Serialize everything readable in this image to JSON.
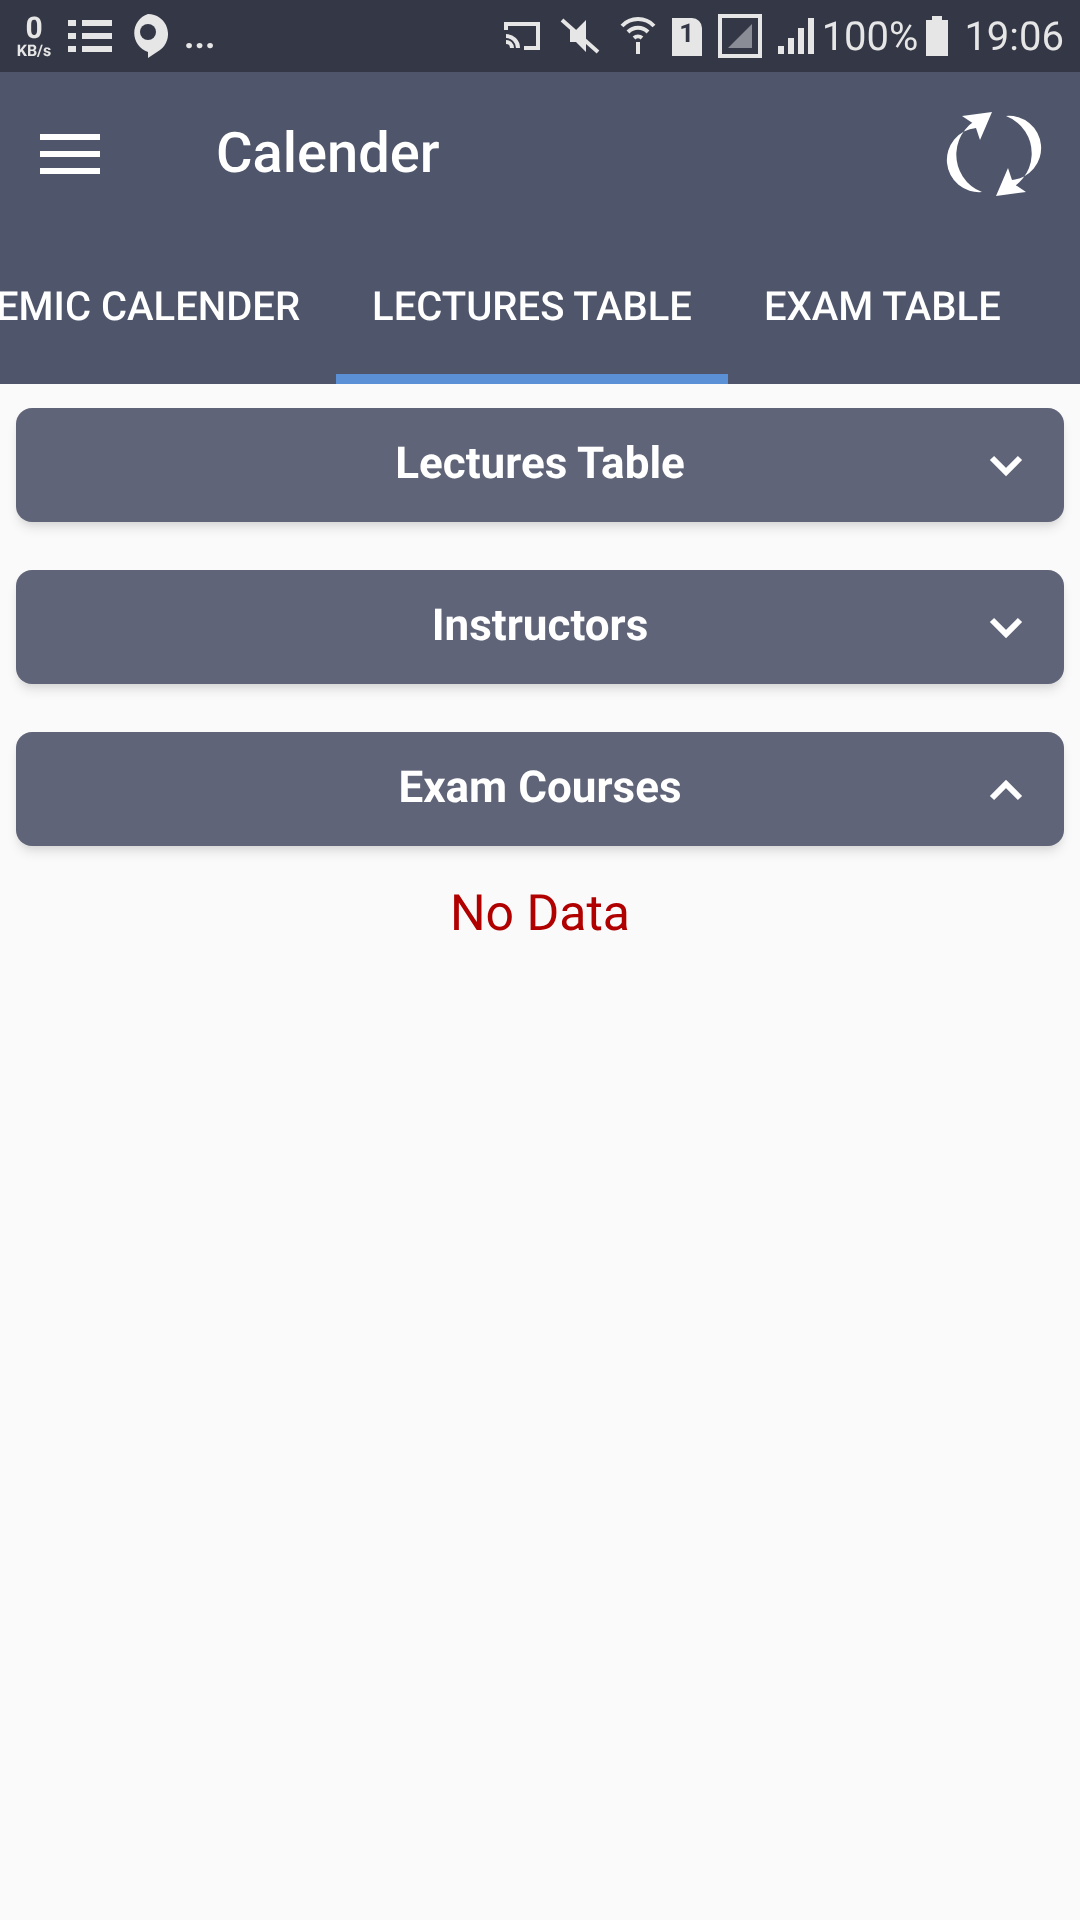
{
  "status_bar": {
    "speed_value": "0",
    "speed_unit": "KB/s",
    "more": "...",
    "sim": "1",
    "battery": "100%",
    "time": "19:06"
  },
  "app_bar": {
    "title": "Calender"
  },
  "tabs": [
    {
      "label": "EMIC CALENDER",
      "selected": false
    },
    {
      "label": "LECTURES TABLE",
      "selected": true
    },
    {
      "label": "EXAM TABLE",
      "selected": false
    }
  ],
  "sections": [
    {
      "title": "Lectures Table",
      "expanded": false
    },
    {
      "title": "Instructors",
      "expanded": false
    },
    {
      "title": "Exam Courses",
      "expanded": true,
      "message": "No Data"
    }
  ]
}
